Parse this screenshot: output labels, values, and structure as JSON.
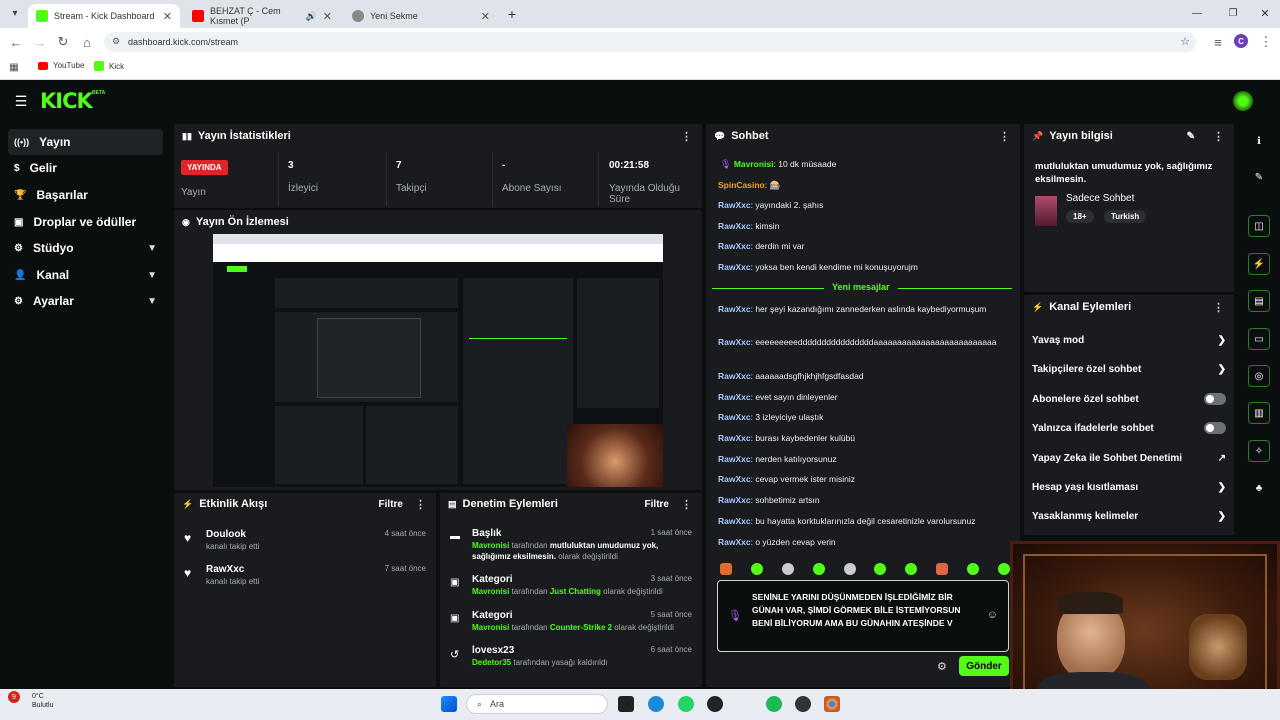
{
  "browser": {
    "tabs": [
      {
        "title": "Stream - Kick Dashboard"
      },
      {
        "title": "BEHZAT Ç - Cem Kısmet (P"
      },
      {
        "title": "Yeni Sekme"
      }
    ],
    "url": "dashboard.kick.com/stream",
    "bookmarks": [
      "YouTube",
      "Kick"
    ],
    "profile_initial": "C"
  },
  "app": {
    "logo": "KICK",
    "logo_badge": "BETA",
    "sidebar": [
      {
        "label": "Yayın"
      },
      {
        "label": "Gelir"
      },
      {
        "label": "Başarılar"
      },
      {
        "label": "Droplar ve ödüller"
      },
      {
        "label": "Stüdyo"
      },
      {
        "label": "Kanal"
      },
      {
        "label": "Ayarlar"
      }
    ]
  },
  "stats": {
    "title": "Yayın İstatistikleri",
    "live_badge": "YAYINDA",
    "live_label": "Yayın",
    "items": [
      {
        "value": "3",
        "label": "İzleyici"
      },
      {
        "value": "7",
        "label": "Takipçi"
      },
      {
        "value": "-",
        "label": "Abone Sayısı"
      },
      {
        "value": "00:21:58",
        "label": "Yayında Olduğu Süre"
      }
    ]
  },
  "preview": {
    "title": "Yayın Ön İzlemesi"
  },
  "activity": {
    "title": "Etkinlik Akışı",
    "filter": "Filtre",
    "items": [
      {
        "user": "Doulook",
        "desc": "kanalı takip etti",
        "time": "4 saat önce"
      },
      {
        "user": "RawXxc",
        "desc": "kanalı takip etti",
        "time": "7 saat önce"
      }
    ]
  },
  "moderation": {
    "title": "Denetim Eylemleri",
    "filter": "Filtre",
    "items": [
      {
        "kind": "Başlık",
        "time": "1 saat önce",
        "actor": "Mavronisi",
        "mid": " tarafından ",
        "value": "mutluluktan umudumuz yok, sağlığımız eksilmesin.",
        "end": " olarak değiştirildi"
      },
      {
        "kind": "Kategori",
        "time": "3 saat önce",
        "actor": "Mavronisi",
        "mid": " tarafından ",
        "value": "Just Chatting",
        "end": " olarak değiştirildi"
      },
      {
        "kind": "Kategori",
        "time": "5 saat önce",
        "actor": "Mavronisi",
        "mid": " tarafından ",
        "value": "Counter-Strike 2",
        "end": " olarak değiştirildi"
      },
      {
        "kind": "lovesx23",
        "time": "6 saat önce",
        "actor": "Dedetor35",
        "mid": " tarafından yasağı kaldırıldı",
        "value": "",
        "end": ""
      }
    ]
  },
  "chat": {
    "title": "Sohbet",
    "new_messages": "Yeni mesajlar",
    "messages": [
      {
        "user": "Mavronisi",
        "text": ": 10 dk müsaade"
      },
      {
        "user": "SpinCasino",
        "text": ": "
      },
      {
        "user": "RawXxc",
        "text": ": yayındaki 2. şahıs"
      },
      {
        "user": "RawXxc",
        "text": ": kimsin"
      },
      {
        "user": "RawXxc",
        "text": ": derdin mi var"
      },
      {
        "user": "RawXxc",
        "text": ": yoksa ben kendi kendime mi konuşuyorujm"
      },
      {
        "user": "RawXxc",
        "text": ": her şeyi kazandığımı zannederken aslında kaybediyormuşum"
      },
      {
        "user": "RawXxc",
        "text": ": eeeeeeeeeddddddddddddddddaaaaaaaaaaaaaaaaaaaaaaaaaa"
      },
      {
        "user": "RawXxc",
        "text": ": aaaaaadsgfhjkhjhfgsdfasdad"
      },
      {
        "user": "RawXxc",
        "text": ": evet sayın dinleyenler"
      },
      {
        "user": "RawXxc",
        "text": ": 3 izleyiciye ulaştık"
      },
      {
        "user": "RawXxc",
        "text": ": burası kaybedenler kulübü"
      },
      {
        "user": "RawXxc",
        "text": ": nerden katılıyorsunuz"
      },
      {
        "user": "RawXxc",
        "text": ": cevap vermek ister misiniz"
      },
      {
        "user": "RawXxc",
        "text": ": sohbetimiz artsın"
      },
      {
        "user": "RawXxc",
        "text": ": bu hayatta korktuklarınızla değil cesaretinizle varolursunuz"
      },
      {
        "user": "RawXxc",
        "text": ": o yüzden cevap verin"
      }
    ],
    "input_text": "SENİNLE YARINI DÜŞÜNMEDEN İŞLEDİĞİMİZ BİR GÜNAH VAR, ŞİMDİ GÖRMEK BİLE İSTEMİYORSUN BENİ BİLİYORUM AMA BU GÜNAHIN ATEŞİNDE V",
    "send_label": "Gönder"
  },
  "info": {
    "title": "Yayın bilgisi",
    "stream_title": "mutluluktan umudumuz yok, sağlığımız eksilmesin.",
    "category": "Sadece Sohbet",
    "tags": [
      "18+",
      "Turkish"
    ]
  },
  "actions": {
    "title": "Kanal Eylemleri",
    "items": [
      {
        "label": "Yavaş mod",
        "control": "chevron"
      },
      {
        "label": "Takipçilere özel sohbet",
        "control": "chevron"
      },
      {
        "label": "Abonelere özel sohbet",
        "control": "toggle"
      },
      {
        "label": "Yalnızca ifadelerle sohbet",
        "control": "toggle"
      },
      {
        "label": "Yapay Zeka ile Sohbet Denetimi",
        "control": "external"
      },
      {
        "label": "Hesap yaşı kısıtlaması",
        "control": "chevron"
      },
      {
        "label": "Yasaklanmış kelimeler",
        "control": "chevron"
      }
    ]
  },
  "taskbar": {
    "weather_temp": "0°C",
    "weather_desc": "Bulutlu",
    "weather_badge": "9",
    "search_placeholder": "Ara"
  },
  "colors": {
    "accent": "#53fc18",
    "live": "#e0252a",
    "panel": "#191b1f",
    "bg": "#0b0e0f"
  }
}
